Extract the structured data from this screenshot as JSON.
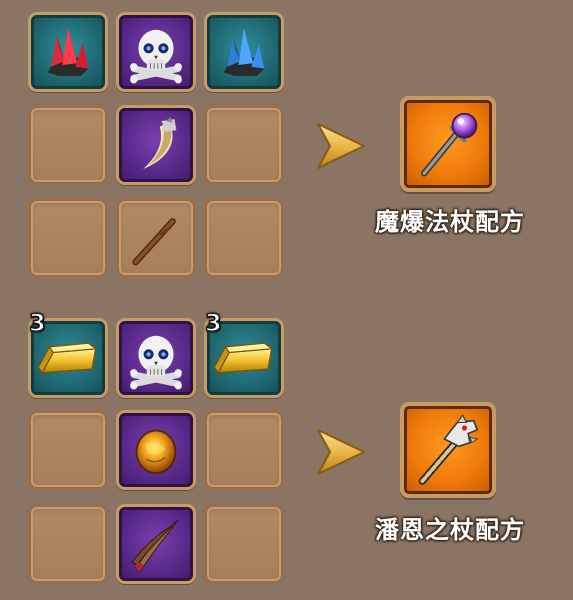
{
  "recipes": [
    {
      "result": {
        "label": "魔爆法杖配方",
        "icon": "purple-orb-staff-icon",
        "frame_color": "#f07a0a"
      },
      "ingredients": [
        {
          "row": 1,
          "col": 1,
          "icon": "red-crystal-icon",
          "rarity": "teal",
          "quantity": null
        },
        {
          "row": 1,
          "col": 2,
          "icon": "skull-crossbones-icon",
          "rarity": "purple",
          "quantity": null
        },
        {
          "row": 1,
          "col": 3,
          "icon": "blue-crystal-icon",
          "rarity": "teal",
          "quantity": null
        },
        {
          "row": 2,
          "col": 1,
          "icon": null,
          "rarity": "empty",
          "quantity": null
        },
        {
          "row": 2,
          "col": 2,
          "icon": "fang-icon",
          "rarity": "purple",
          "quantity": null
        },
        {
          "row": 2,
          "col": 3,
          "icon": null,
          "rarity": "empty",
          "quantity": null
        },
        {
          "row": 3,
          "col": 1,
          "icon": null,
          "rarity": "empty",
          "quantity": null
        },
        {
          "row": 3,
          "col": 2,
          "icon": "wooden-stick-icon",
          "rarity": "empty",
          "quantity": null
        },
        {
          "row": 3,
          "col": 3,
          "icon": null,
          "rarity": "empty",
          "quantity": null
        }
      ]
    },
    {
      "result": {
        "label": "潘恩之杖配方",
        "icon": "dragon-head-staff-icon",
        "frame_color": "#f07a0a"
      },
      "ingredients": [
        {
          "row": 1,
          "col": 1,
          "icon": "gold-bar-icon",
          "rarity": "teal",
          "quantity": "3"
        },
        {
          "row": 1,
          "col": 2,
          "icon": "skull-crossbones-icon",
          "rarity": "purple",
          "quantity": null
        },
        {
          "row": 1,
          "col": 3,
          "icon": "gold-bar-icon",
          "rarity": "teal",
          "quantity": "3"
        },
        {
          "row": 2,
          "col": 1,
          "icon": null,
          "rarity": "empty",
          "quantity": null
        },
        {
          "row": 2,
          "col": 2,
          "icon": "amber-orb-icon",
          "rarity": "purple",
          "quantity": null
        },
        {
          "row": 2,
          "col": 3,
          "icon": null,
          "rarity": "empty",
          "quantity": null
        },
        {
          "row": 3,
          "col": 1,
          "icon": null,
          "rarity": "empty",
          "quantity": null
        },
        {
          "row": 3,
          "col": 2,
          "icon": "claw-blades-icon",
          "rarity": "purple",
          "quantity": null
        },
        {
          "row": 3,
          "col": 3,
          "icon": null,
          "rarity": "empty",
          "quantity": null
        }
      ]
    }
  ],
  "colors": {
    "background": "#8a7564",
    "slot_empty": "#a67e5a",
    "slot_teal": "#1f6a73",
    "slot_purple": "#5a2a8c",
    "arrow": "#e8b340"
  }
}
